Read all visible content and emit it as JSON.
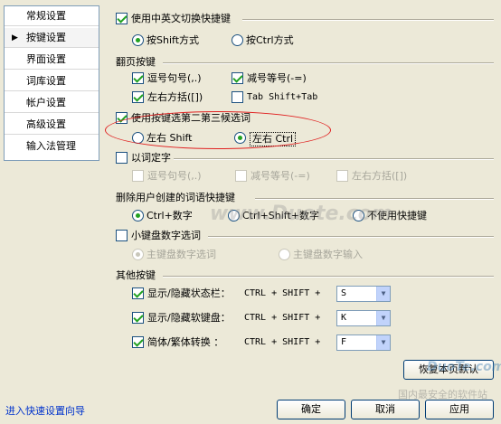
{
  "sidebar": {
    "items": [
      {
        "label": "常规设置"
      },
      {
        "label": "按键设置"
      },
      {
        "label": "界面设置"
      },
      {
        "label": "词库设置"
      },
      {
        "label": "帐户设置"
      },
      {
        "label": "高级设置"
      },
      {
        "label": "输入法管理"
      }
    ]
  },
  "switch": {
    "label": "使用中英文切换快捷键",
    "opt_shift": "按Shift方式",
    "opt_ctrl": "按Ctrl方式"
  },
  "paging": {
    "title": "翻页按键",
    "comma_period": "逗号句号(,.)",
    "minus_equal": "减号等号(-=)",
    "brackets": "左右方括([])",
    "tab": "Tab Shift+Tab"
  },
  "candidate": {
    "label": "使用按键选第二第三候选词",
    "left_right_shift": "左右 Shift",
    "left_right_ctrl": "左右 Ctrl"
  },
  "fixed": {
    "label": "以词定字",
    "comma_period": "逗号句号(,.)",
    "minus_equal": "减号等号(-=)",
    "brackets": "左右方括([])"
  },
  "delete_word": {
    "title": "删除用户创建的词语快捷键",
    "opt1": "Ctrl+数字",
    "opt2": "Ctrl+Shift+数字",
    "opt3": "不使用快捷键"
  },
  "numpad": {
    "label": "小键盘数字选词",
    "opt1": "主键盘数字选词",
    "opt2": "主键盘数字输入"
  },
  "other": {
    "title": "其他按键",
    "rows": [
      {
        "label": "显示/隐藏状态栏：",
        "combo": "CTRL + SHIFT +",
        "key": "S"
      },
      {
        "label": "显示/隐藏软键盘：",
        "combo": "CTRL + SHIFT +",
        "key": "K"
      },
      {
        "label": "简体/繁体转换   ：",
        "combo": "CTRL + SHIFT +",
        "key": "F"
      }
    ]
  },
  "restore_button": "恢复本页默认",
  "footer": {
    "wizard_link": "进入快速设置向导",
    "ok": "确定",
    "cancel": "取消",
    "apply": "应用"
  },
  "watermarks": {
    "center": "www.Duote.com",
    "corner_logo": "DuoTe.com",
    "corner_text": "国内最安全的软件站"
  },
  "colors": {
    "dialog_bg": "#ece9d8",
    "check_green": "#21a121",
    "highlight_ellipse": "#e02020",
    "link": "#0033cc"
  }
}
